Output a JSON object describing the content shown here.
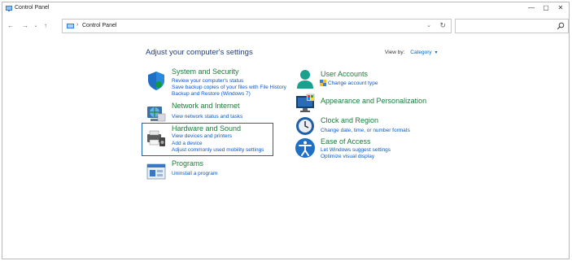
{
  "window": {
    "title": "Control Panel",
    "min_glyph": "—",
    "max_glyph": "▢",
    "close_glyph": "✕"
  },
  "nav": {
    "back_glyph": "←",
    "forward_glyph": "→",
    "recent_glyph": "⌄",
    "up_glyph": "↑"
  },
  "address": {
    "separator": "›",
    "path": "Control Panel",
    "dropdown_glyph": "⌄",
    "refresh_glyph": "↻"
  },
  "search": {
    "placeholder": "",
    "value": ""
  },
  "main": {
    "heading": "Adjust your computer's settings",
    "view_by_label": "View by:",
    "view_by_value": "Category",
    "view_by_caret": "▾"
  },
  "categories": {
    "system": {
      "title": "System and Security",
      "links": [
        "Review your computer's status",
        "Save backup copies of your files with File History",
        "Backup and Restore (Windows 7)"
      ]
    },
    "network": {
      "title": "Network and Internet",
      "links": [
        "View network status and tasks"
      ]
    },
    "hardware": {
      "title": "Hardware and Sound",
      "links": [
        "View devices and printers",
        "Add a device",
        "Adjust commonly used mobility settings"
      ]
    },
    "programs": {
      "title": "Programs",
      "links": [
        "Uninstall a program"
      ]
    },
    "users": {
      "title": "User Accounts",
      "links": [
        "Change account type"
      ]
    },
    "appearance": {
      "title": "Appearance and Personalization",
      "links": []
    },
    "clock": {
      "title": "Clock and Region",
      "links": [
        "Change date, time, or number formats"
      ]
    },
    "ease": {
      "title": "Ease of Access",
      "links": [
        "Let Windows suggest settings",
        "Optimize visual display"
      ]
    }
  },
  "colors": {
    "heading": "#1f3d7a",
    "category_title": "#1e7a3a",
    "link": "#0b58c7",
    "highlight_border": "#1e64b4"
  }
}
